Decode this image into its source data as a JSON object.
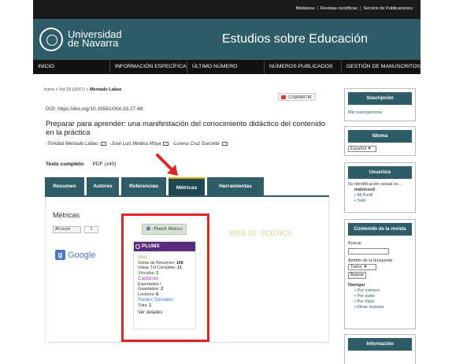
{
  "toplinks": [
    "Biblioteca",
    "Revistas científicas",
    "Servicio de Publicaciones"
  ],
  "header": {
    "university_line1": "Universidad",
    "university_line2": "de Navarra",
    "journal": "Estudios sobre Educación"
  },
  "nav": [
    "INICIO",
    "INFORMACIÓN ESPECÍFICA",
    "ÚLTIMO NÚMERO",
    "NÚMEROS PUBLICADOS",
    "GESTIÓN DE MANUSCRITOS"
  ],
  "breadcrumb": {
    "prefix": "Inicio > Vol 33 (2017) > ",
    "current": "Mentado Labao"
  },
  "share_label": "COMPARTIR",
  "doi": "DOI: https://doi.org/10.15581/004.33.27-48",
  "article_title": "Preparar para aprender: una manifestación del conocimiento didáctico del contenido en la práctica",
  "authors": [
    "-Trinidad Mentado Labao",
    "-José Luis Medina Moya",
    "-Lorena Cruz Garcette"
  ],
  "fulltext": {
    "label": "Texto completo:",
    "link": "PDF",
    "count": "(±40)"
  },
  "tabs": [
    "Resumen",
    "Autores",
    "Referencias",
    "Métricas",
    "Herramientas"
  ],
  "metrics": {
    "heading": "Métricas",
    "altmetric_label": "Alt  score",
    "altmetric_count": "1",
    "google_label": "Google",
    "wos_label": "WEB OF SCIENCE",
    "plumx_button": "PlumX Metrics",
    "plumx_logo": "PLUMX",
    "uso": {
      "title": "Uso",
      "lines": [
        {
          "label": "Vistas de Resumen:",
          "value": "168"
        },
        {
          "label": "Vistas Txt Completo:",
          "value": "11"
        },
        {
          "label": "Vínculos:",
          "value": "1"
        }
      ]
    },
    "capturas": {
      "title": "Capturas",
      "lines": [
        {
          "label": "Exportados /",
          "value": ""
        },
        {
          "label": "Guardados:",
          "value": "2"
        },
        {
          "label": "Lectores:",
          "value": "6"
        }
      ]
    },
    "redes": {
      "title": "Redes Sociales",
      "lines": [
        {
          "label": "Tuits:",
          "value": "1"
        }
      ]
    },
    "ver_detalles": "Ver detalles"
  },
  "sidebar": {
    "suscripcion": {
      "title": "Suscripción",
      "link": "Mis suscripciones"
    },
    "idioma": {
      "title": "Idioma",
      "value": "Español"
    },
    "usuario": {
      "title": "Usuario/a",
      "intro": "Su identificación actual es...",
      "user": "malonsod",
      "links": [
        "Mi Perfil",
        "Salir"
      ]
    },
    "contenido": {
      "title": "Contenido de la revista",
      "buscar": "Buscar",
      "ambito": "Ámbito de la búsqueda",
      "ambito_value": "Todos",
      "buscar_btn": "Buscar",
      "navegar": "Navegar",
      "links": [
        "Por número",
        "Por autor",
        "Por título",
        "Otras revistas"
      ]
    },
    "informacion": {
      "title": "Información"
    }
  },
  "colors": {
    "header": "#2e5c67",
    "highlight": "#e02525",
    "plumx": "#5b2b7d"
  }
}
